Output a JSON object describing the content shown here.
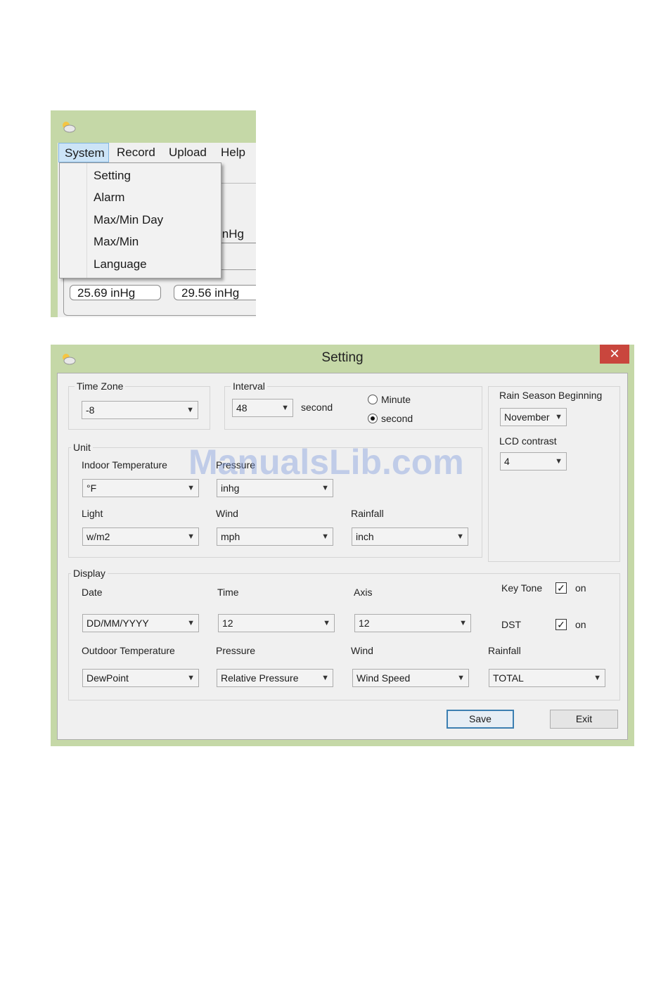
{
  "menu_window": {
    "menubar": [
      "System",
      "Record",
      "Upload",
      "Help"
    ],
    "dropdown_items": [
      "Setting",
      "Alarm",
      "Max/Min Day",
      "Max/Min",
      "Language"
    ],
    "behind_value": "inHg",
    "field_left": "25.69 inHg",
    "field_right": "29.56 inHg",
    "icon": "weather-app-icon"
  },
  "setting": {
    "title": "Setting",
    "close_glyph": "✕",
    "time_zone": {
      "label": "Time Zone",
      "value": "-8"
    },
    "interval": {
      "label": "Interval",
      "value": "48",
      "unit": "second",
      "radio_minute": "Minute",
      "radio_second": "second",
      "selected": "second"
    },
    "rain_season": {
      "label": "Rain Season Beginning",
      "value": "November"
    },
    "lcd_contrast": {
      "label": "LCD contrast",
      "value": "4"
    },
    "unit": {
      "label": "Unit",
      "indoor_temperature": {
        "label": "Indoor Temperature",
        "value": "°F"
      },
      "pressure": {
        "label": "Pressure",
        "value": "inhg"
      },
      "light": {
        "label": "Light",
        "value": "w/m2"
      },
      "wind": {
        "label": "Wind",
        "value": "mph"
      },
      "rainfall": {
        "label": "Rainfall",
        "value": "inch"
      }
    },
    "display": {
      "label": "Display",
      "date": {
        "label": "Date",
        "value": "DD/MM/YYYY"
      },
      "time": {
        "label": "Time",
        "value": "12"
      },
      "axis": {
        "label": "Axis",
        "value": "12"
      },
      "key_tone": {
        "label": "Key Tone",
        "on_label": "on",
        "checked": true
      },
      "dst": {
        "label": "DST",
        "on_label": "on",
        "checked": true
      },
      "outdoor_temperature": {
        "label": "Outdoor Temperature",
        "value": "DewPoint"
      },
      "pressure": {
        "label": "Pressure",
        "value": "Relative Pressure"
      },
      "wind": {
        "label": "Wind",
        "value": "Wind Speed"
      },
      "rainfall": {
        "label": "Rainfall",
        "value": "TOTAL"
      }
    },
    "buttons": {
      "save": "Save",
      "exit": "Exit"
    }
  },
  "watermark": "ManualsLib.com",
  "colors": {
    "window_frame": "#c5d8a7",
    "close_button": "#c9463d",
    "menu_highlight": "#cce4f7"
  }
}
